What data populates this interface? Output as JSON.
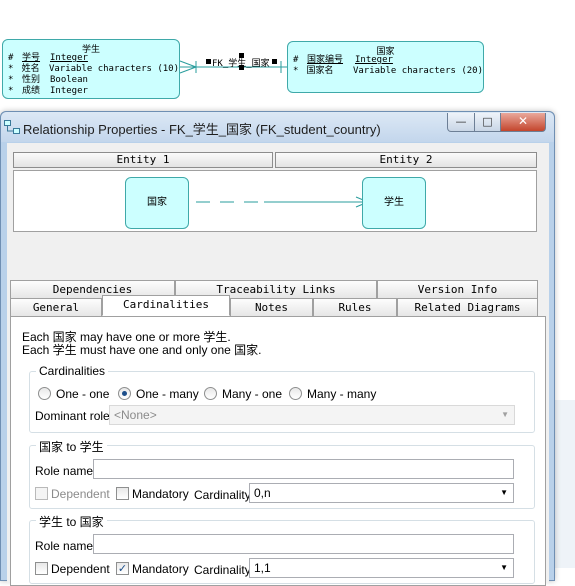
{
  "diagram": {
    "entity_student": {
      "name": "学生",
      "columns": [
        {
          "marker": "#",
          "name": "学号",
          "type": "Integer",
          "pk": true
        },
        {
          "marker": "*",
          "name": "姓名",
          "type": "Variable characters (10)",
          "pk": false
        },
        {
          "marker": "*",
          "name": "性别",
          "type": "Boolean",
          "pk": false
        },
        {
          "marker": "*",
          "name": "成绩",
          "type": "Integer",
          "pk": false
        }
      ]
    },
    "entity_country": {
      "name": "国家",
      "columns": [
        {
          "marker": "#",
          "name": "国家编号",
          "type": "Integer",
          "pk": true
        },
        {
          "marker": "*",
          "name": "国家名",
          "type": "Variable characters (20)",
          "pk": false
        }
      ]
    },
    "relationship_label": "FK_学生_国家",
    "line_color": "#2a9d9d",
    "entity_fill": "#ccffff"
  },
  "dialog": {
    "title": "Relationship Properties - FK_学生_国家 (FK_student_country)",
    "window_buttons": {
      "minimize": "—",
      "maximize": "□",
      "close": "✕"
    },
    "entity1_label": "Entity 1",
    "entity2_label": "Entity 2",
    "preview": {
      "left_entity": "国家",
      "right_entity": "学生"
    },
    "tabs_back": [
      "Dependencies",
      "Traceability Links",
      "Version Info"
    ],
    "tabs_front": [
      "General",
      "Cardinalities",
      "Notes",
      "Rules",
      "Related Diagrams"
    ],
    "active_tab": "Cardinalities",
    "sentence1": "Each 国家 may have one or more 学生.",
    "sentence2": "Each 学生 must have one and only one 国家.",
    "cardinalities": {
      "group_title": "Cardinalities",
      "options": [
        "One - one",
        "One - many",
        "Many - one",
        "Many - many"
      ],
      "selected": "One - many",
      "dominant_role_label": "Dominant role:",
      "dominant_role_value": "<None>"
    },
    "role1": {
      "group_title": "国家 to 学生",
      "role_name_label": "Role name:",
      "role_name_value": "",
      "dependent_label": "Dependent",
      "dependent_checked": false,
      "mandatory_label": "Mandatory",
      "mandatory_checked": false,
      "cardinality_label": "Cardinality:",
      "cardinality_value": "0,n"
    },
    "role2": {
      "group_title": "学生 to 国家",
      "role_name_label": "Role name:",
      "role_name_value": "",
      "dependent_label": "Dependent",
      "dependent_checked": false,
      "mandatory_label": "Mandatory",
      "mandatory_checked": true,
      "cardinality_label": "Cardinality:",
      "cardinality_value": "1,1"
    }
  }
}
